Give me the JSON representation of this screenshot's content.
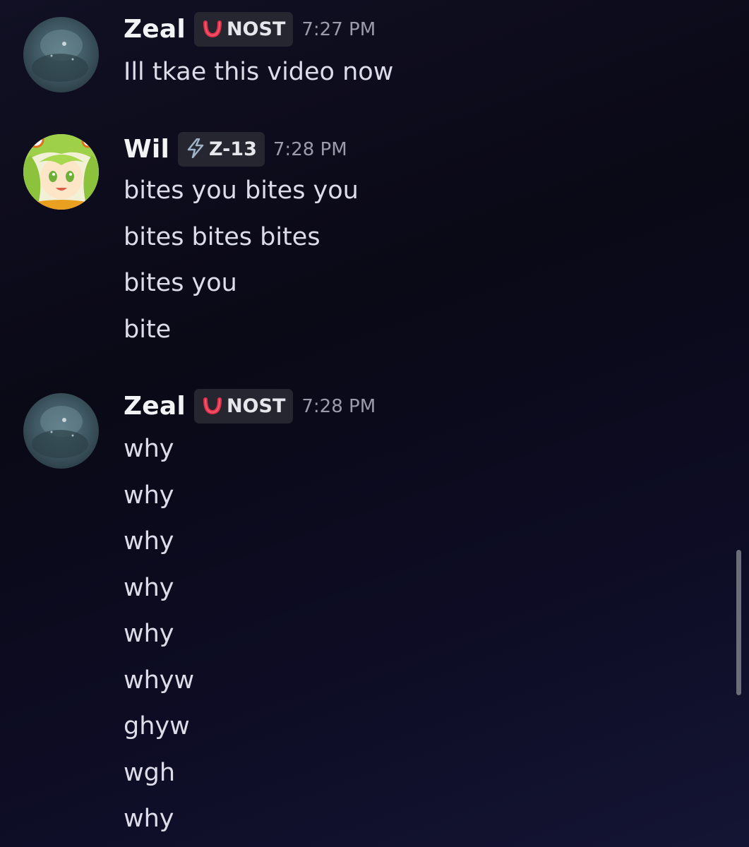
{
  "messages": [
    {
      "author": "Zeal",
      "tag": "NOST",
      "tag_icon": "red-horseshoe-icon",
      "time": "7:27 PM",
      "avatar": "zeal-avatar",
      "lines": [
        "Ill tkae this video now"
      ]
    },
    {
      "author": "Wil",
      "tag": "Z-13",
      "tag_icon": "lightning-icon",
      "time": "7:28 PM",
      "avatar": "wil-avatar",
      "lines": [
        "bites you bites you",
        "bites bites bites",
        "bites you",
        "bite"
      ]
    },
    {
      "author": "Zeal",
      "tag": "NOST",
      "tag_icon": "red-horseshoe-icon",
      "time": "7:28 PM",
      "avatar": "zeal-avatar",
      "lines": [
        "why",
        "why",
        "why",
        "why",
        "why",
        "whyw",
        "ghyw",
        "wgh",
        "why"
      ]
    }
  ],
  "colors": {
    "tag_background": "#25262f",
    "timestamp": "#9a9cab",
    "nost_icon": "#e0314b",
    "z13_icon": "#9fb3c8"
  }
}
